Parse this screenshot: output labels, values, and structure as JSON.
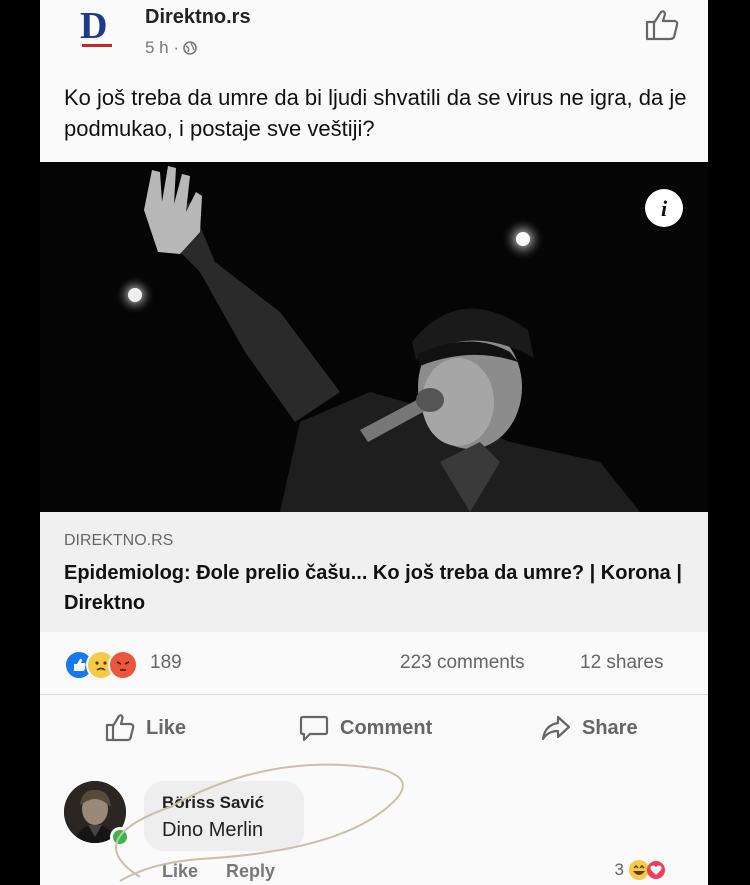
{
  "post": {
    "page_name": "Direktno.rs",
    "timestamp": "5 h ·",
    "text": "Ko još treba da umre da bi ljudi shvatili da se virus ne igra, da je podmukao, i postaje sve veštiji?"
  },
  "link": {
    "domain": "DIREKTNO.RS",
    "title": "Epidemiolog: Đole prelio čašu... Ko još treba da umre? | Korona | Direktno"
  },
  "stats": {
    "reactions": "189",
    "comments": "223 comments",
    "shares": "12 shares"
  },
  "actions": {
    "like": "Like",
    "comment": "Comment",
    "share": "Share"
  },
  "comment": {
    "author": "Böriss Savić",
    "text": "Dino Merlin",
    "like": "Like",
    "reply": "Reply",
    "reaction_count": "3"
  },
  "colors": {
    "brand_blue": "#1d3a8c",
    "brand_red": "#c8262b",
    "like_blue": "#1877f2",
    "angry_red": "#e9573f",
    "sad_yellow": "#f7c948",
    "online_green": "#3bb54a"
  },
  "icons": {
    "logo": "direktno-logo",
    "top_like": "thumbs-up-outline-icon",
    "privacy": "globe-icon",
    "info": "info-icon",
    "like": "like-icon",
    "comment": "comment-icon",
    "share": "share-icon"
  }
}
